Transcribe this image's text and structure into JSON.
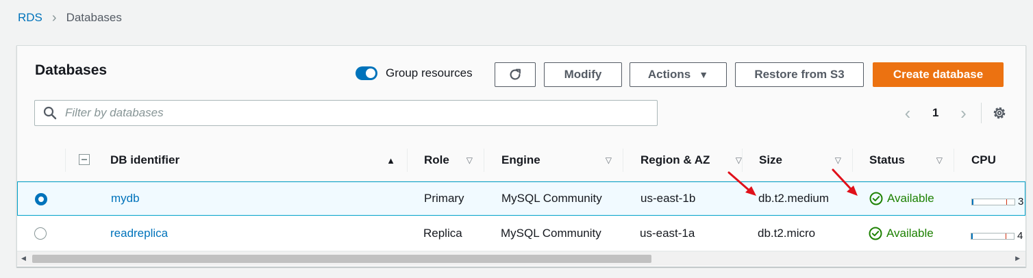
{
  "breadcrumb": {
    "root": "RDS",
    "current": "Databases"
  },
  "panel": {
    "title": "Databases"
  },
  "toolbar": {
    "group_resources_label": "Group resources",
    "modify_label": "Modify",
    "actions_label": "Actions",
    "restore_label": "Restore from S3",
    "create_label": "Create database"
  },
  "search": {
    "placeholder": "Filter by databases"
  },
  "pagination": {
    "current_page": "1"
  },
  "table": {
    "columns": [
      "DB identifier",
      "Role",
      "Engine",
      "Region & AZ",
      "Size",
      "Status",
      "CPU"
    ],
    "rows": [
      {
        "id": "mydb",
        "role": "Primary",
        "engine": "MySQL Community",
        "region": "us-east-1b",
        "size": "db.t2.medium",
        "status": "Available",
        "cpu": "3",
        "selected": true
      },
      {
        "id": "readreplica",
        "role": "Replica",
        "engine": "MySQL Community",
        "region": "us-east-1a",
        "size": "db.t2.micro",
        "status": "Available",
        "cpu": "4",
        "selected": false
      }
    ]
  },
  "colors": {
    "accent": "#0073bb",
    "primary_button": "#ec7211",
    "status_ok": "#1d8102",
    "annotation": "#e0101a"
  },
  "icons": [
    "refresh-icon",
    "caret-down-icon",
    "search-icon",
    "chevron-left-icon",
    "chevron-right-icon",
    "gear-icon",
    "check-circle-icon",
    "sort-asc-icon",
    "sort-desc-icon"
  ]
}
